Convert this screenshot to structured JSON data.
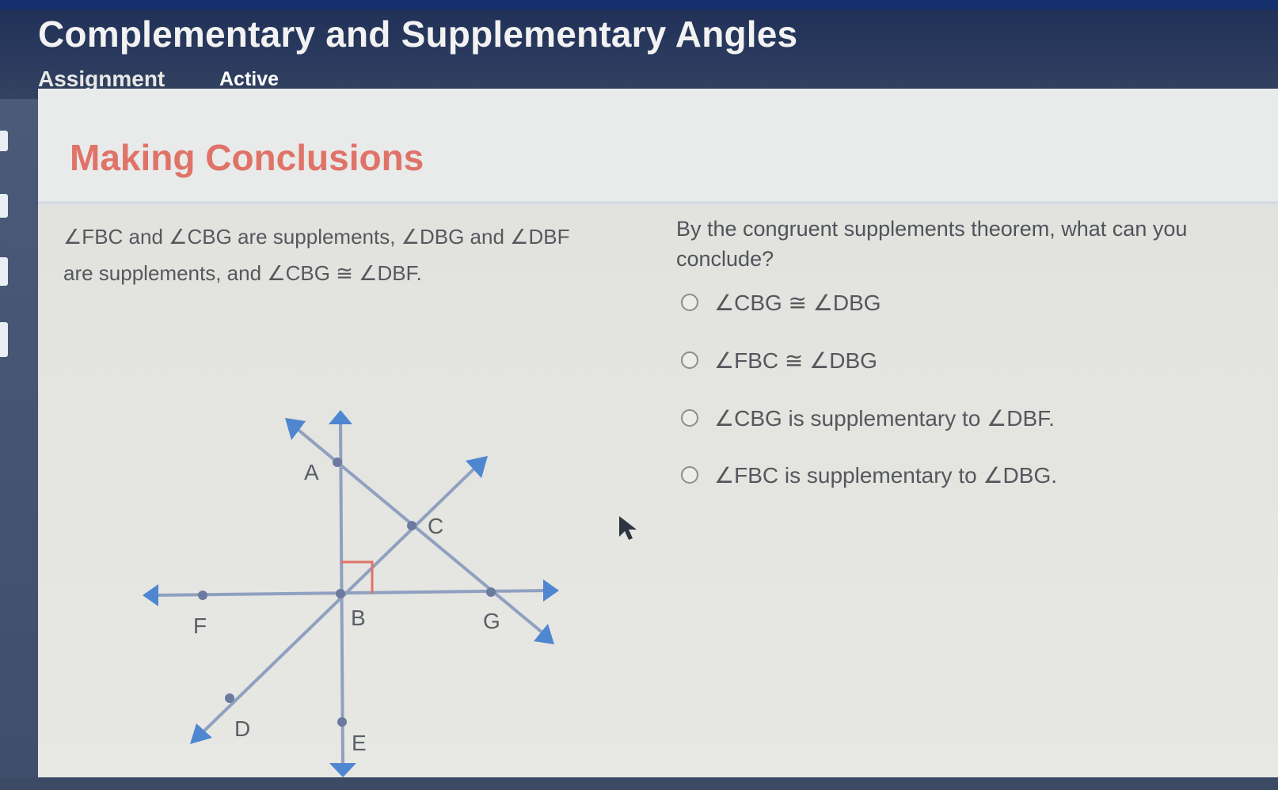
{
  "header": {
    "title": "Complementary and Supplementary Angles",
    "assignment_label": "Assignment",
    "status": "Active"
  },
  "section": {
    "title": "Making Conclusions"
  },
  "problem": {
    "line1": "∠FBC and ∠CBG are supplements, ∠DBG and ∠DBF",
    "line2": "are supplements, and ∠CBG ≅ ∠DBF."
  },
  "question": {
    "text": "By the congruent supplements theorem, what can you conclude?",
    "options": [
      {
        "label": "∠CBG ≅ ∠DBG"
      },
      {
        "label": "∠FBC ≅ ∠DBG"
      },
      {
        "label": "∠CBG is supplementary to ∠DBF."
      },
      {
        "label": "∠FBC is supplementary to ∠DBG."
      }
    ]
  },
  "diagram": {
    "points": {
      "A": "A",
      "B": "B",
      "C": "C",
      "D": "D",
      "E": "E",
      "F": "F",
      "G": "G"
    },
    "line_color": "#8fa0c0",
    "arrow_color": "#4f86d0",
    "right_angle_color": "#e07368"
  },
  "colors": {
    "accent_title": "#e07368",
    "header_bg": "#24345a"
  }
}
